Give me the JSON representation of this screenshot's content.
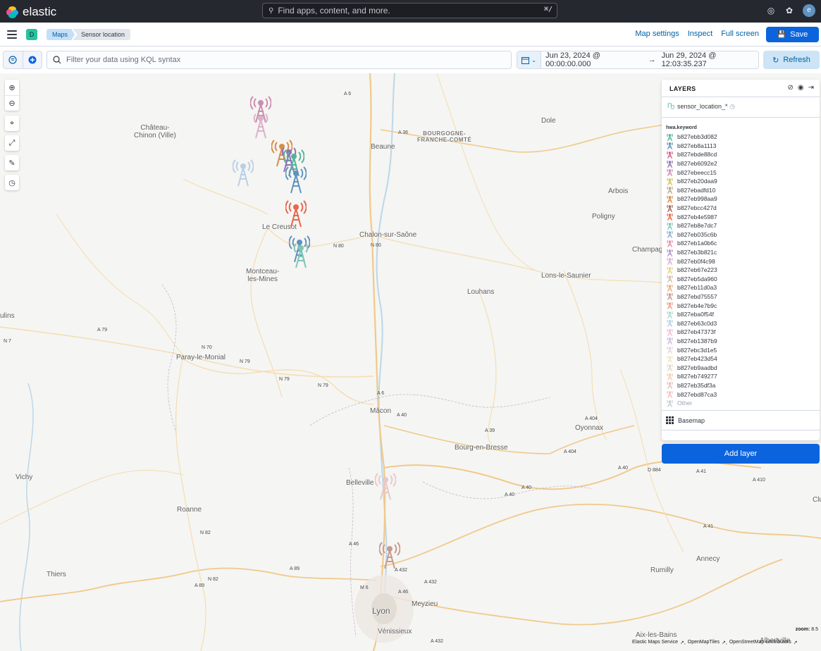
{
  "topbar": {
    "brand": "elastic",
    "search_placeholder": "Find apps, content, and more.",
    "search_shortcut": "⌘/",
    "avatar_letter": "e"
  },
  "appbar": {
    "space_letter": "D",
    "breadcrumbs": [
      "Maps",
      "Sensor location"
    ],
    "links": [
      "Map settings",
      "Inspect",
      "Full screen"
    ],
    "save_label": "Save"
  },
  "query": {
    "placeholder": "Filter your data using KQL syntax",
    "start": "Jun 23, 2024 @ 00:00:00.000",
    "arrow": "→",
    "end": "Jun 29, 2024 @ 12:03:35.237",
    "refresh_label": "Refresh"
  },
  "layers_panel": {
    "title": "LAYERS",
    "layer_name": "sensor_location_*",
    "field_label": "hwa.keyword",
    "legend": [
      {
        "label": "b827ebb3d082",
        "color": "#54b399"
      },
      {
        "label": "b827eb8a1113",
        "color": "#6092c0"
      },
      {
        "label": "b827ebde88cd",
        "color": "#d36086"
      },
      {
        "label": "b827eb6092e2",
        "color": "#9170b8"
      },
      {
        "label": "b827ebeecc15",
        "color": "#ca8eae"
      },
      {
        "label": "b827eb20daa9",
        "color": "#d6bf57"
      },
      {
        "label": "b827ebadfd10",
        "color": "#b9a888"
      },
      {
        "label": "b827eb998aa9",
        "color": "#da8b45"
      },
      {
        "label": "b827ebcc427d",
        "color": "#aa6556"
      },
      {
        "label": "b827eb4e5987",
        "color": "#e7664c"
      },
      {
        "label": "b827eb8e7dc7",
        "color": "#7fc6b5"
      },
      {
        "label": "b827eb035c6b",
        "color": "#8fb1d3"
      },
      {
        "label": "b827eb1a0b6c",
        "color": "#e490aa"
      },
      {
        "label": "b827eb3b821c",
        "color": "#ad96cc"
      },
      {
        "label": "b827eb0f4c98",
        "color": "#dcb1c9"
      },
      {
        "label": "b827eb67e223",
        "color": "#e3d388"
      },
      {
        "label": "b827eb5da960",
        "color": "#cdc0a9"
      },
      {
        "label": "b827eb11d0a3",
        "color": "#e9ad78"
      },
      {
        "label": "b827ebd75557",
        "color": "#c79a91"
      },
      {
        "label": "b827eb4e7b9c",
        "color": "#f09a87"
      },
      {
        "label": "b827eba0f54f",
        "color": "#a9d9cd"
      },
      {
        "label": "b827eb63c0d3",
        "color": "#b8cfe5"
      },
      {
        "label": "b827eb47373f",
        "color": "#efbfcd"
      },
      {
        "label": "b827eb1387b9",
        "color": "#cbbde1"
      },
      {
        "label": "b827ebc3d1e5",
        "color": "#e9d3df"
      },
      {
        "label": "b827eb423d54",
        "color": "#f0e6bb"
      },
      {
        "label": "b827eb9aadbd",
        "color": "#e0d8cb"
      },
      {
        "label": "b827eb749277",
        "color": "#f3cdab"
      },
      {
        "label": "b827eb35df3a",
        "color": "#dfc4be"
      },
      {
        "label": "b827ebd87ca3",
        "color": "#f5c2b6"
      }
    ],
    "other_label": "Other",
    "basemap_label": "Basemap",
    "add_layer_label": "Add layer"
  },
  "map": {
    "zoom_label": "zoom:",
    "zoom_value": "8.5",
    "attribution": [
      "Elastic Maps Service",
      "OpenMapTiles",
      "OpenStreetMap contributors"
    ],
    "places": [
      {
        "name": "Château-\nChinon (Ville)",
        "cls": "place"
      },
      {
        "name": "BOURGOGNE-\nFRANCHE-COMTÉ",
        "cls": "place region"
      },
      {
        "name": "Beaune",
        "cls": "place"
      },
      {
        "name": "Dole",
        "cls": "place"
      },
      {
        "name": "Arbois",
        "cls": "place"
      },
      {
        "name": "Poligny",
        "cls": "place"
      },
      {
        "name": "Champag",
        "cls": "place"
      },
      {
        "name": "Le Creusot",
        "cls": "place"
      },
      {
        "name": "Chalon-sur-Saône",
        "cls": "place"
      },
      {
        "name": "Montceau-\nles-Mines",
        "cls": "place"
      },
      {
        "name": "Louhans",
        "cls": "place"
      },
      {
        "name": "Lons-le-Saunier",
        "cls": "place"
      },
      {
        "name": "ulins",
        "cls": "place"
      },
      {
        "name": "Paray-le-Monial",
        "cls": "place"
      },
      {
        "name": "Mâcon",
        "cls": "place"
      },
      {
        "name": "Oyonnax",
        "cls": "place"
      },
      {
        "name": "Bourg-en-Bresse",
        "cls": "place"
      },
      {
        "name": "Vichy",
        "cls": "place"
      },
      {
        "name": "Belleville",
        "cls": "place"
      },
      {
        "name": "Roanne",
        "cls": "place"
      },
      {
        "name": "Thiers",
        "cls": "place"
      },
      {
        "name": "Meyzieu",
        "cls": "place"
      },
      {
        "name": "Lyon",
        "cls": "place"
      },
      {
        "name": "Vénissieux",
        "cls": "place"
      },
      {
        "name": "Annecy",
        "cls": "place"
      },
      {
        "name": "Rumilly",
        "cls": "place"
      },
      {
        "name": "Aix-les-Bains",
        "cls": "place"
      },
      {
        "name": "Albertville",
        "cls": "place"
      },
      {
        "name": "Clu",
        "cls": "place"
      }
    ],
    "roads": [
      "A 6",
      "A 36",
      "N 80",
      "N 80",
      "A 79",
      "N 7",
      "N 70",
      "N 79",
      "N 79",
      "N 79",
      "A 6",
      "A 40",
      "A 39",
      "A 404",
      "A 404",
      "A 40",
      "D 884",
      "A 41",
      "A 410",
      "A 40",
      "A 40",
      "A 41",
      "A 46",
      "N 82",
      "N 82",
      "A 89",
      "A 89",
      "A 432",
      "A 432",
      "A 46",
      "M 6",
      "A 432"
    ]
  }
}
